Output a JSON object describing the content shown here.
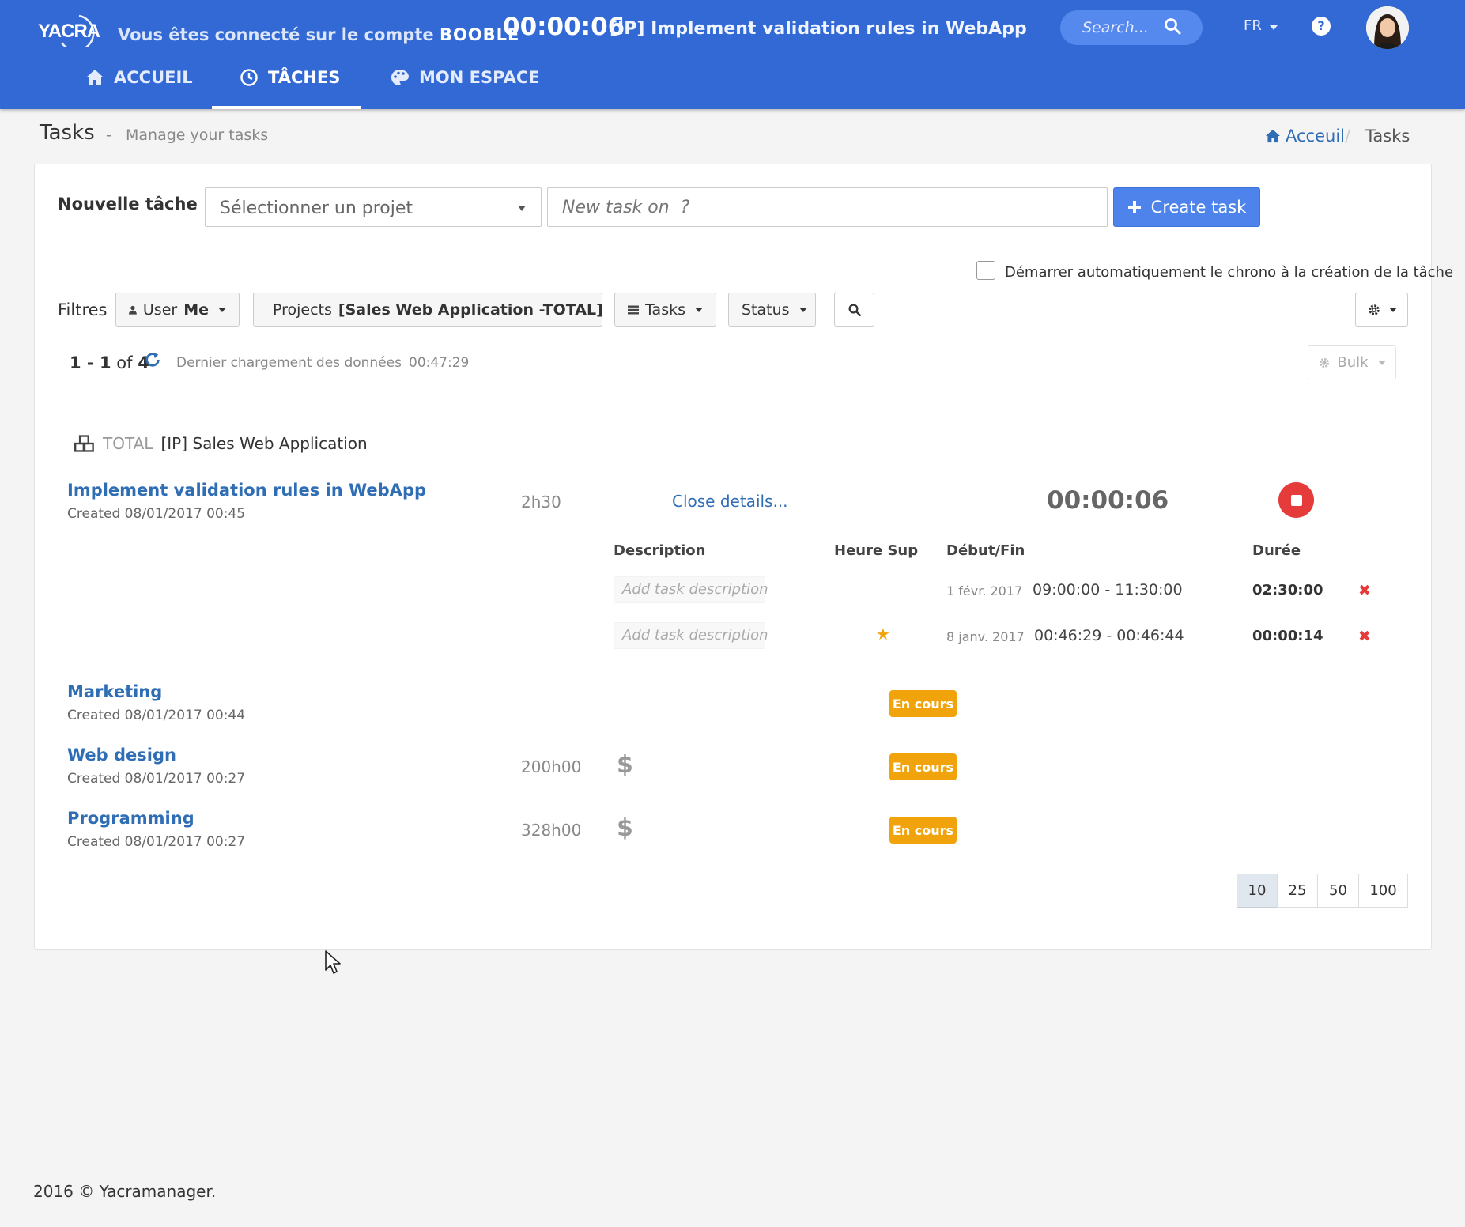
{
  "header": {
    "logo_text": "YACRA",
    "connected_prefix": "Vous êtes connecté sur le compte",
    "account": "BOOBLE",
    "timer": "00:00:06",
    "current_task": "[IP] Implement validation rules in WebApp",
    "search_placeholder": "Search...",
    "lang": "FR",
    "help": "?",
    "brand_color": "#3369d4"
  },
  "nav": {
    "items": [
      {
        "label": "ACCUEIL",
        "icon": "home-icon"
      },
      {
        "label": "TÂCHES",
        "icon": "clock-icon",
        "active": true
      },
      {
        "label": "MON ESPACE",
        "icon": "palette-icon"
      }
    ]
  },
  "page": {
    "title": "Tasks",
    "separator": "-",
    "subtitle": "Manage your tasks",
    "breadcrumb": [
      "Acceuil",
      "/",
      "Tasks"
    ]
  },
  "new_task": {
    "label": "Nouvelle tâche",
    "project_select": "Sélectionner un projet",
    "task_placeholder": "New task on  ?",
    "create_label": "Create task",
    "auto_start_label": "Démarrer automatiquement le chrono à la création de la tâche"
  },
  "filters": {
    "label": "Filtres",
    "user_label": "User",
    "user_value": "Me",
    "projects_label": "Projects",
    "projects_value": "[Sales Web Application -TOTAL]",
    "tasks_label": "Tasks",
    "status_label": "Status"
  },
  "listing": {
    "range": "1 - 1",
    "of": "of",
    "total": "4",
    "reload_label": "Dernier chargement des données",
    "reload_time": "00:47:29",
    "bulk_label": "Bulk"
  },
  "project": {
    "client": "TOTAL",
    "name": "[IP] Sales Web Application"
  },
  "tasks": [
    {
      "title": "Implement validation rules in WebApp",
      "created": "Created 08/01/2017 00:45",
      "estimate": "2h30",
      "details_link": "Close details...",
      "timer": "00:00:06"
    },
    {
      "title": "Marketing",
      "created": "Created 08/01/2017 00:44",
      "status": "En cours"
    },
    {
      "title": "Web design",
      "created": "Created 08/01/2017 00:27",
      "estimate": "200h00",
      "billable": "$",
      "status": "En cours"
    },
    {
      "title": "Programming",
      "created": "Created 08/01/2017 00:27",
      "estimate": "328h00",
      "billable": "$",
      "status": "En cours"
    }
  ],
  "details": {
    "headers": {
      "description": "Description",
      "overtime": "Heure Sup",
      "startend": "Début/Fin",
      "duration": "Durée"
    },
    "rows": [
      {
        "description_placeholder": "Add task description",
        "date": "1 févr. 2017",
        "time": "09:00:00 - 11:30:00",
        "duration": "02:30:00",
        "overtime": false
      },
      {
        "description_placeholder": "Add task description",
        "date": "8 janv. 2017",
        "time": "00:46:29 - 00:46:44",
        "duration": "00:00:14",
        "overtime": true
      }
    ]
  },
  "page_sizes": [
    "10",
    "25",
    "50",
    "100"
  ],
  "footer": "2016 © Yacramanager."
}
